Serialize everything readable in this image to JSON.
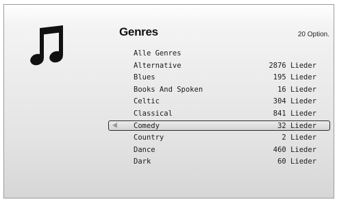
{
  "header": {
    "title": "Genres",
    "option_count": "20 Option."
  },
  "icon": "music-note-icon",
  "genres": [
    {
      "name": "Alle Genres",
      "count": ""
    },
    {
      "name": "Alternative",
      "count": "2876 Lieder"
    },
    {
      "name": "Blues",
      "count": "195 Lieder"
    },
    {
      "name": "Books And Spoken",
      "count": "16 Lieder"
    },
    {
      "name": "Celtic",
      "count": "304 Lieder"
    },
    {
      "name": "Classical",
      "count": "841 Lieder"
    },
    {
      "name": "Comedy",
      "count": "32 Lieder",
      "selected": true
    },
    {
      "name": "Country",
      "count": "2 Lieder"
    },
    {
      "name": "Dance",
      "count": "460 Lieder"
    },
    {
      "name": "Dark",
      "count": "60 Lieder"
    }
  ],
  "colors": {
    "background_top": "#f7f7f7",
    "background_bottom": "#d6d6d6",
    "text": "#1a1a1a",
    "selection_border": "#2a2a2a"
  }
}
